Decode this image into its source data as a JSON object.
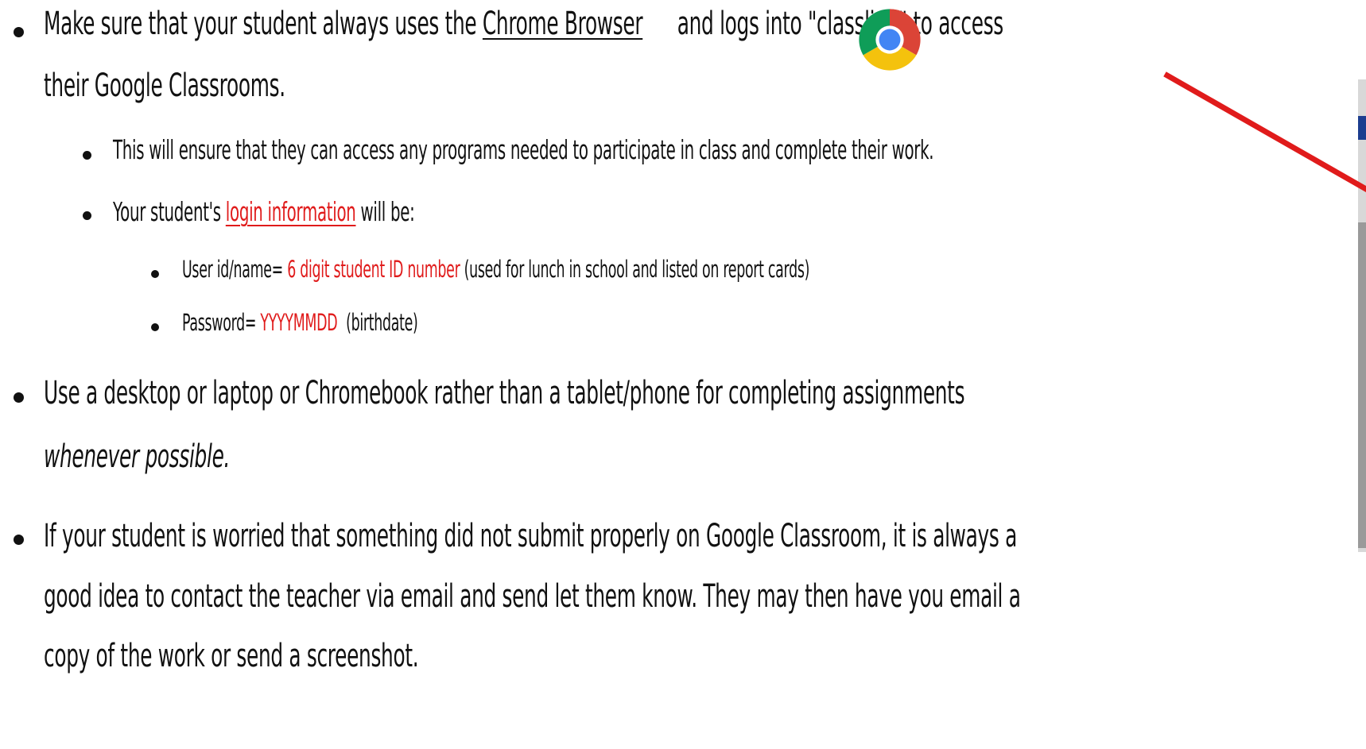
{
  "bullets": {
    "chrome": {
      "text_before": "Make sure that your student always uses the ",
      "chrome_link": "Chrome Browser",
      "text_after": " and logs into \"classlink\" to access",
      "continuation": "their Google Classrooms.",
      "sub": {
        "ensure": "This will ensure that they can access any programs needed to participate in class and complete their work.",
        "login": {
          "prefix": "Your student's ",
          "link": "login information",
          "suffix": " will be:",
          "user": {
            "label": "User id/name= ",
            "value": "6 digit student ID number",
            "note": " (used for lunch in school and listed on report cards)"
          },
          "password": {
            "label": "Password= ",
            "value": "YYYYMMDD",
            "note": "(birthdate)"
          }
        }
      }
    },
    "device": {
      "line1": "Use a desktop or laptop or Chromebook rather than a tablet/phone for completing assignments",
      "line2": "whenever possible."
    },
    "submit": {
      "line1": "If your student is worried that something did not submit properly on Google Classroom, it is always a",
      "line2": "good idea to contact the teacher via email and send let them know.  They may then have you email a",
      "line3": "copy of the work or send a screenshot."
    }
  },
  "icons": {
    "chrome": "chrome-logo-icon",
    "arrow": "red-arrow-icon"
  },
  "colors": {
    "text": "#111111",
    "accent_red": "#e01b1b",
    "chrome_red": "#db4437",
    "chrome_yellow": "#f4c20d",
    "chrome_green": "#0f9d58",
    "chrome_blue": "#4285f4"
  }
}
